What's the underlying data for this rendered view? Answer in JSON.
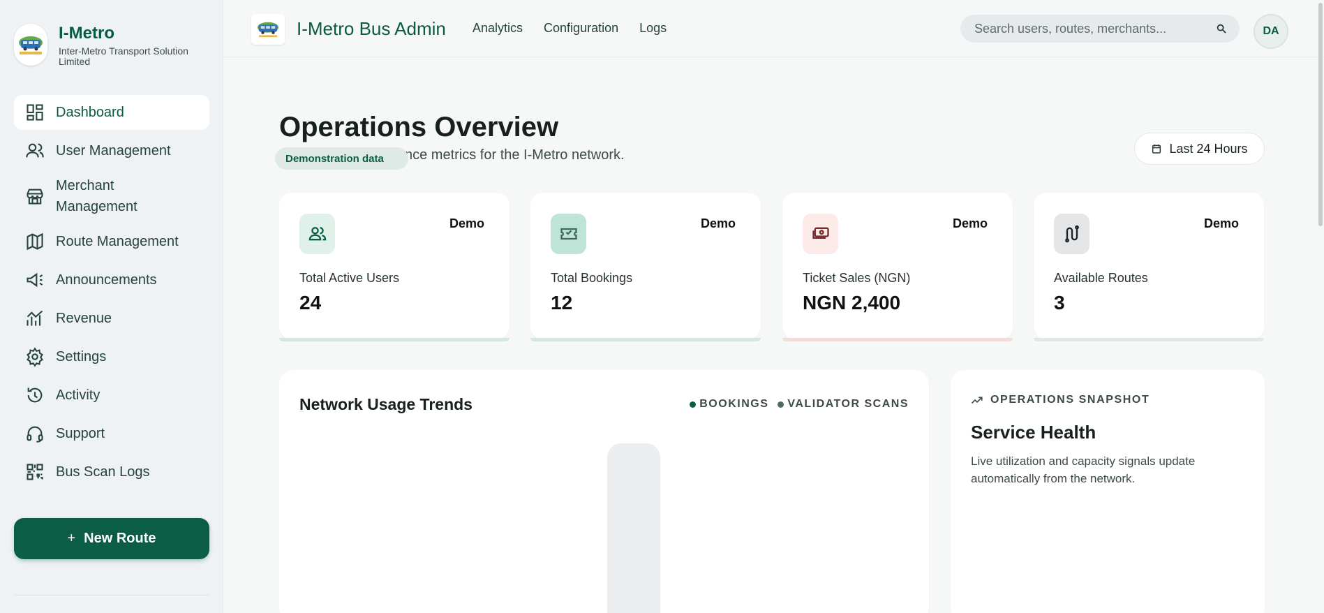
{
  "sidebar": {
    "brand_title": "I-Metro",
    "brand_subtitle": "Inter-Metro Transport Solution Limited",
    "items": [
      {
        "label": "Dashboard",
        "icon": "dashboard-icon",
        "active": true
      },
      {
        "label": "User Management",
        "icon": "users-icon"
      },
      {
        "label": "Merchant Management",
        "icon": "store-icon"
      },
      {
        "label": "Route Management",
        "icon": "map-icon"
      },
      {
        "label": "Announcements",
        "icon": "megaphone-icon"
      },
      {
        "label": "Revenue",
        "icon": "chart-icon"
      },
      {
        "label": "Settings",
        "icon": "gear-icon"
      },
      {
        "label": "Activity",
        "icon": "history-icon"
      },
      {
        "label": "Support",
        "icon": "headset-icon"
      },
      {
        "label": "Bus Scan Logs",
        "icon": "qr-icon"
      }
    ],
    "new_route_label": "New Route"
  },
  "header": {
    "title": "I-Metro Bus Admin",
    "nav": [
      "Analytics",
      "Configuration",
      "Logs"
    ],
    "search_placeholder": "Search users, routes, merchants...",
    "avatar_initials": "DA"
  },
  "main": {
    "title": "Operations Overview",
    "subtitle_visible": "nce metrics for the I-Metro network.",
    "demo_pill": "Demonstration data",
    "range_label": "Last 24 Hours",
    "cards": [
      {
        "label": "Total Active Users",
        "value": "24",
        "badge": "Demo",
        "icon": "users-icon"
      },
      {
        "label": "Total Bookings",
        "value": "12",
        "badge": "Demo",
        "icon": "ticket-icon"
      },
      {
        "label": "Ticket Sales (NGN)",
        "value": "NGN 2,400",
        "badge": "Demo",
        "icon": "cash-icon"
      },
      {
        "label": "Available Routes",
        "value": "3",
        "badge": "Demo",
        "icon": "route-icon"
      }
    ],
    "usage": {
      "title": "Network Usage Trends",
      "legend": [
        "BOOKINGS",
        "VALIDATOR SCANS"
      ]
    },
    "snapshot": {
      "eyebrow": "OPERATIONS SNAPSHOT",
      "title": "Service Health",
      "description": "Live utilization and capacity signals update automatically from the network."
    }
  },
  "colors": {
    "brand": "#0b5d46",
    "bookings_dot": "#0b5d46",
    "scans_dot": "#4f6b62"
  }
}
